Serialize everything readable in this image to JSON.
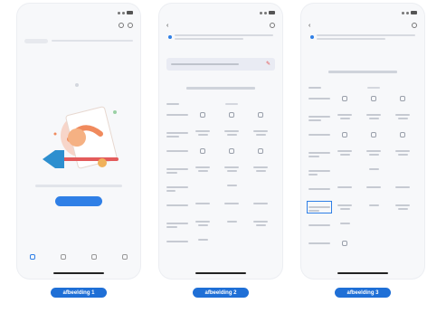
{
  "status_bar": {
    "time": "",
    "icons": [
      "signal-icon",
      "wifi-icon",
      "battery-icon"
    ]
  },
  "screen1": {
    "title": "",
    "filter_label": "",
    "empty_text": "",
    "action_button": "",
    "tabs": [
      "",
      "",
      "",
      ""
    ]
  },
  "screen2": {
    "title": "",
    "notice": "",
    "field_value": "",
    "section_title": ""
  },
  "screen3": {
    "title": "",
    "notice": "",
    "section_title": ""
  },
  "captions": [
    "afbeelding 1",
    "afbeelding 2",
    "afbeelding 3"
  ],
  "colors": {
    "accent": "#2f7fe6",
    "caption": "#1f6fd6",
    "edit_icon": "#e34a4a"
  }
}
